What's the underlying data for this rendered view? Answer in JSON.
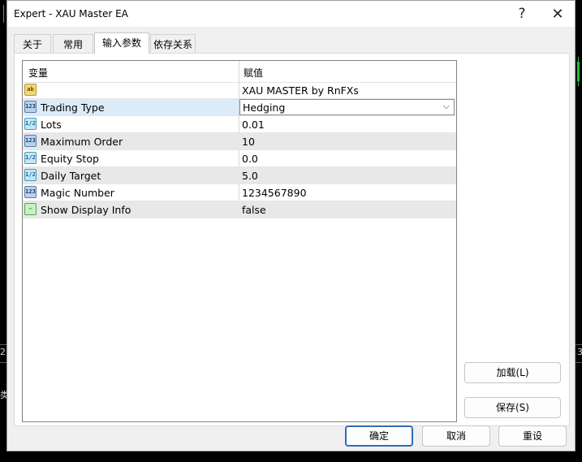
{
  "window": {
    "title": "Expert - XAU Master EA",
    "help_glyph": "?",
    "close_glyph": "✕"
  },
  "background": {
    "left_edge_text": [
      "2",
      "类"
    ],
    "right_edge_text": "3"
  },
  "tabs": [
    {
      "label": "关于",
      "active": false
    },
    {
      "label": "常用",
      "active": false
    },
    {
      "label": "输入参数",
      "active": true
    },
    {
      "label": "依存关系",
      "active": false
    }
  ],
  "grid": {
    "headers": {
      "variable": "变量",
      "value": "赋值"
    },
    "rows": [
      {
        "type_icon": "string-icon",
        "icon_text": "ab",
        "name": "",
        "value": "XAU MASTER by RnFXs"
      },
      {
        "type_icon": "integer-icon",
        "icon_text": "123",
        "name": "Trading Type",
        "value": "Hedging",
        "editing": true
      },
      {
        "type_icon": "double-icon",
        "icon_text": "1/2",
        "name": "Lots",
        "value": "0.01"
      },
      {
        "type_icon": "integer-icon",
        "icon_text": "123",
        "name": "Maximum Order",
        "value": "10"
      },
      {
        "type_icon": "double-icon",
        "icon_text": "1/2",
        "name": "Equity Stop",
        "value": "0.0"
      },
      {
        "type_icon": "double-icon",
        "icon_text": "1/2",
        "name": "Daily Target",
        "value": "5.0"
      },
      {
        "type_icon": "integer-icon",
        "icon_text": "123",
        "name": "Magic Number",
        "value": "1234567890"
      },
      {
        "type_icon": "bool-icon",
        "icon_text": "~",
        "name": "Show Display Info",
        "value": "false"
      }
    ]
  },
  "buttons": {
    "load": "加载(L)",
    "save": "保存(S)",
    "ok": "确定",
    "cancel": "取消",
    "reset": "重设"
  },
  "colors": {
    "dialog_bg": "#f0f0f0",
    "selected_row": "#dcebf8",
    "alt_row": "#e8e8e8",
    "primary_border": "#2f6eb6",
    "chart_bg": "#000000",
    "chart_tick": "#1fbf3a"
  }
}
